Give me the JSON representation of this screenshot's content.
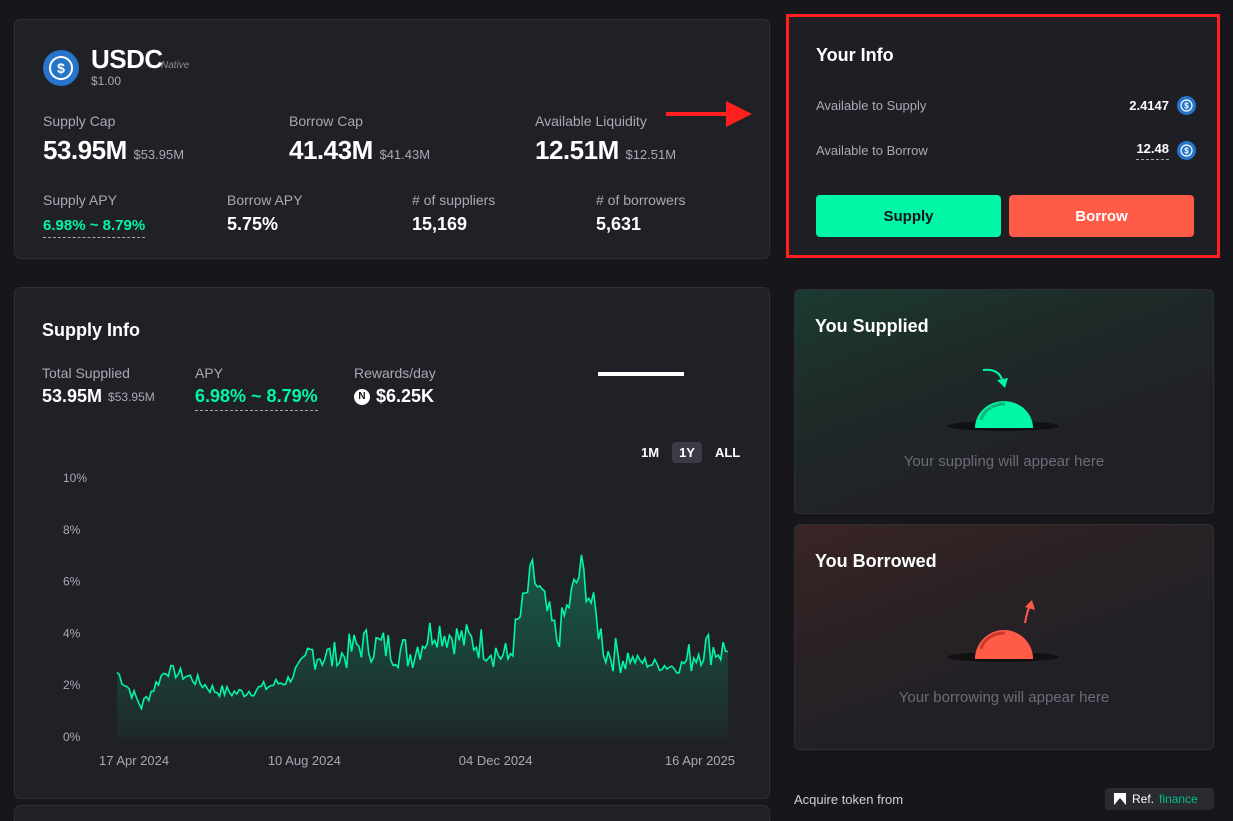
{
  "market": {
    "token": "USDC",
    "tag": "Native",
    "price": "$1.00",
    "supply_cap_label": "Supply Cap",
    "supply_cap": "53.95M",
    "supply_cap_usd": "$53.95M",
    "borrow_cap_label": "Borrow Cap",
    "borrow_cap": "41.43M",
    "borrow_cap_usd": "$41.43M",
    "liquidity_label": "Available Liquidity",
    "liquidity": "12.51M",
    "liquidity_usd": "$12.51M",
    "supply_apy_label": "Supply APY",
    "supply_apy": "6.98% ~ 8.79%",
    "borrow_apy_label": "Borrow APY",
    "borrow_apy": "5.75%",
    "suppliers_label": "# of suppliers",
    "suppliers": "15,169",
    "borrowers_label": "# of borrowers",
    "borrowers": "5,631"
  },
  "your_info": {
    "title": "Your Info",
    "available_supply_label": "Available to Supply",
    "available_supply": "2.4147",
    "available_borrow_label": "Available to Borrow",
    "available_borrow": "12.48",
    "supply_button": "Supply",
    "borrow_button": "Borrow"
  },
  "supply_info": {
    "title": "Supply Info",
    "total_supplied_label": "Total Supplied",
    "total_supplied": "53.95M",
    "total_supplied_usd": "$53.95M",
    "apy_label": "APY",
    "apy": "6.98% ~ 8.79%",
    "rewards_label": "Rewards/day",
    "rewards": "$6.25K",
    "ranges": [
      "1M",
      "1Y",
      "ALL"
    ],
    "active_range": "1Y"
  },
  "chart_data": {
    "type": "area",
    "title": "",
    "xlabel": "",
    "ylabel": "",
    "ylim": [
      0,
      10
    ],
    "y_ticks": [
      "0%",
      "2%",
      "4%",
      "6%",
      "8%",
      "10%"
    ],
    "x_ticks": [
      "17 Apr 2024",
      "10 Aug 2024",
      "04 Dec 2024",
      "16 Apr 2025"
    ],
    "x": [
      "2024-04-17",
      "2024-05-01",
      "2024-05-15",
      "2024-06-01",
      "2024-06-15",
      "2024-07-01",
      "2024-07-15",
      "2024-08-01",
      "2024-08-10",
      "2024-08-20",
      "2024-09-01",
      "2024-09-15",
      "2024-10-01",
      "2024-10-15",
      "2024-11-01",
      "2024-11-15",
      "2024-12-04",
      "2024-12-15",
      "2025-01-01",
      "2025-01-15",
      "2025-02-01",
      "2025-02-15",
      "2025-03-01",
      "2025-03-15",
      "2025-04-01",
      "2025-04-16"
    ],
    "series": [
      {
        "values": [
          2.5,
          1.2,
          2.6,
          2.3,
          1.8,
          1.7,
          1.9,
          2.2,
          3.3,
          3.0,
          3.6,
          3.5,
          3.2,
          4.2,
          3.8,
          3.6,
          3.0,
          6.3,
          3.8,
          6.5,
          3.3,
          3.0,
          2.8,
          2.7,
          3.5,
          3.3
        ]
      }
    ],
    "color": "#00f7a5"
  },
  "you_supplied": {
    "title": "You Supplied",
    "empty": "Your suppling will appear here"
  },
  "you_borrowed": {
    "title": "You Borrowed",
    "empty": "Your borrowing will appear here"
  },
  "acquire": {
    "label": "Acquire token from",
    "source": "Ref.",
    "source_suffix": "finance"
  },
  "colors": {
    "accent_green": "#00f7a5",
    "accent_red": "#ff5b47",
    "highlight": "#ff1f1f"
  }
}
